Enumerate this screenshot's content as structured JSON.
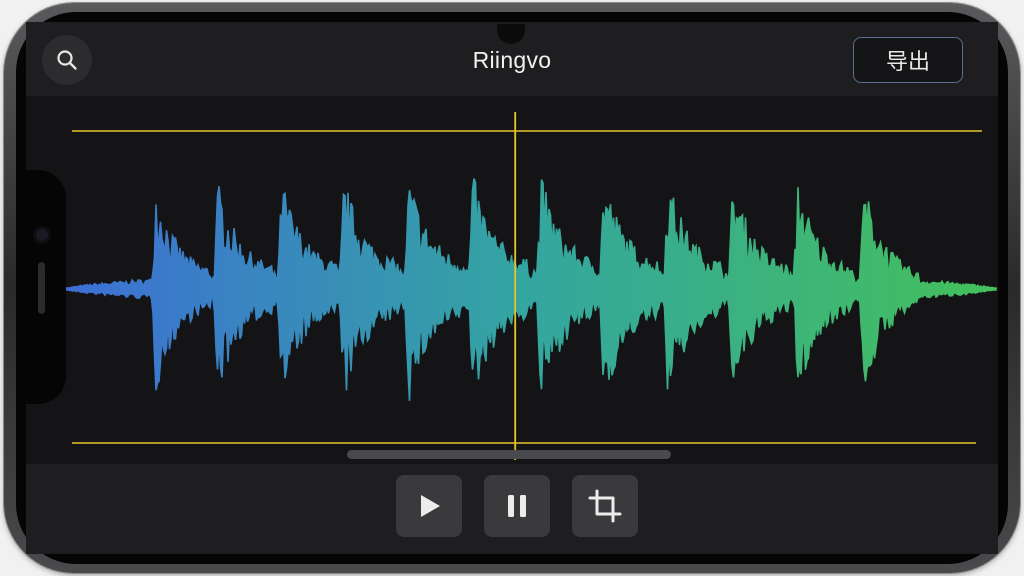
{
  "app": {
    "title": "Riingvo"
  },
  "header": {
    "search_icon": "search-icon",
    "export_label": "导出"
  },
  "waveform": {
    "gradient_start": "#3d6fd6",
    "gradient_mid": "#34a6a0",
    "gradient_end": "#44c05a",
    "selection_line_color": "#e8c42a",
    "playhead_color": "#e8c42a",
    "playhead_position": 0.487
  },
  "controls": {
    "play_icon": "play-icon",
    "pause_icon": "pause-icon",
    "crop_icon": "crop-icon"
  }
}
